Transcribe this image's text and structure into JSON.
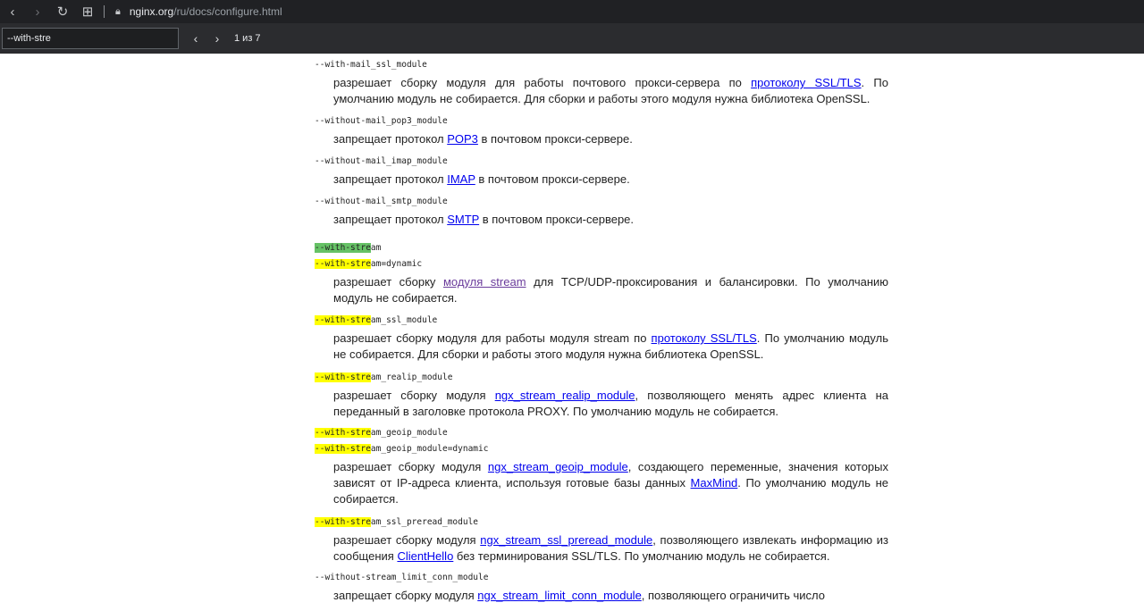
{
  "browser": {
    "url_host": "nginx.org",
    "url_path": "/ru/docs/configure.html",
    "icons": [
      "back-icon",
      "forward-icon",
      "reload-icon",
      "tab-grid-icon",
      "lock-icon"
    ]
  },
  "find": {
    "query": "--with-stre",
    "count": "1 из 7"
  },
  "entries": [
    {
      "terms": [
        {
          "pre": "",
          "hl": "",
          "post": "--with-mail_ssl_module"
        }
      ],
      "desc": [
        "разрешает сборку модуля для работы почтового прокси-сервера по ",
        {
          "link": "протоколу SSL/TLS"
        },
        ". По умолчанию модуль не собирается. Для сборки и работы этого модуля нужна библиотека OpenSSL."
      ]
    },
    {
      "terms": [
        {
          "pre": "",
          "hl": "",
          "post": "--without-mail_pop3_module"
        }
      ],
      "desc": [
        "запрещает протокол ",
        {
          "link": "POP3"
        },
        " в почтовом прокси-сервере."
      ]
    },
    {
      "terms": [
        {
          "pre": "",
          "hl": "",
          "post": "--without-mail_imap_module"
        }
      ],
      "desc": [
        "запрещает протокол ",
        {
          "link": "IMAP"
        },
        " в почтовом прокси-сервере."
      ]
    },
    {
      "terms": [
        {
          "pre": "",
          "hl": "",
          "post": "--without-mail_smtp_module"
        }
      ],
      "desc": [
        "запрещает протокол ",
        {
          "link": "SMTP"
        },
        " в почтовом прокси-сервере."
      ]
    },
    {
      "terms": [
        {
          "hl": "--with-stre",
          "post": "am",
          "current": true
        },
        {
          "hl": "--with-stre",
          "post": "am=dynamic"
        }
      ],
      "desc": [
        "разрешает сборку ",
        {
          "link": "модуля stream",
          "visited": true
        },
        " для TCP/UDP-проксирования и балансировки. По умолчанию модуль не собирается."
      ]
    },
    {
      "terms": [
        {
          "hl": "--with-stre",
          "post": "am_ssl_module"
        }
      ],
      "desc": [
        "разрешает сборку модуля для работы модуля stream по ",
        {
          "link": "протоколу SSL/TLS"
        },
        ". По умолчанию модуль не собирается. Для сборки и работы этого модуля нужна библиотека OpenSSL."
      ]
    },
    {
      "terms": [
        {
          "hl": "--with-stre",
          "post": "am_realip_module"
        }
      ],
      "desc": [
        "разрешает сборку модуля ",
        {
          "link": "ngx_stream_realip_module"
        },
        ", позволяющего менять адрес клиента на переданный в заголовке протокола PROXY. По умолчанию модуль не собирается."
      ]
    },
    {
      "terms": [
        {
          "hl": "--with-stre",
          "post": "am_geoip_module"
        },
        {
          "hl": "--with-stre",
          "post": "am_geoip_module=dynamic"
        }
      ],
      "desc": [
        "разрешает сборку модуля ",
        {
          "link": "ngx_stream_geoip_module"
        },
        ", создающего переменные, значения которых зависят от IP-адреса клиента, используя готовые базы данных ",
        {
          "link": "MaxMind"
        },
        ". По умолчанию модуль не собирается."
      ]
    },
    {
      "terms": [
        {
          "hl": "--with-stre",
          "post": "am_ssl_preread_module"
        }
      ],
      "desc": [
        "разрешает сборку модуля ",
        {
          "link": "ngx_stream_ssl_preread_module"
        },
        ", позволяющего извлекать информацию из сообщения ",
        {
          "link": "ClientHello"
        },
        " без терминирования SSL/TLS. По умолчанию модуль не собирается."
      ]
    },
    {
      "terms": [
        {
          "pre": "",
          "hl": "",
          "post": "--without-stream_limit_conn_module"
        }
      ],
      "desc": [
        "запрещает сборку модуля ",
        {
          "link": "ngx_stream_limit_conn_module"
        },
        ", позволяющего ограничить число"
      ]
    }
  ]
}
